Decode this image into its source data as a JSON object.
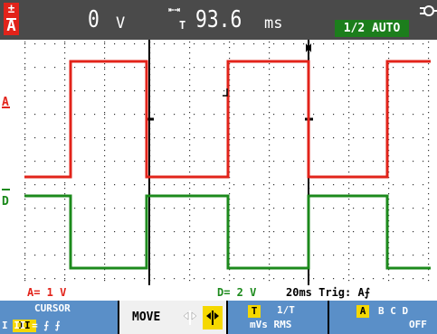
{
  "topbar": {
    "channel_letter": "A",
    "channel_symbol": "±",
    "voltage_value": "0",
    "voltage_unit": "V",
    "delta_t_symbol": "⇤⇥",
    "delta_t_sub": "T",
    "time_value": "93.6",
    "time_unit": "ms",
    "auto_badge": "1/2 AUTO"
  },
  "display": {
    "trace_a_label": "A",
    "trace_d_label": "D",
    "trace_a_color": "#e2231a",
    "trace_d_color": "#1c8a1c",
    "trace_a_level_high": 1.0,
    "trace_a_level_low": 0.0
  },
  "status": {
    "channel_a_range": "A= 1 V",
    "channel_d_range": "D= 2 V",
    "timebase_trigger": "20ms Trig: A⨍"
  },
  "softkeys": {
    "cursor_title": "CURSOR",
    "cursor_options": "I II = ⨍ ⨍",
    "move_label": "MOVE",
    "t_key": "T",
    "t_line1": "1/T",
    "t_line2": "mVs RMS",
    "ch_key": "A",
    "ch_line1": "B C D",
    "ch_line2": "OFF"
  },
  "colors": {
    "topbar_bg": "#4a4a4a",
    "softkey_bg": "#5a8fc8",
    "auto_badge_bg": "#1c7e1c",
    "highlight_yellow": "#f5d800"
  }
}
